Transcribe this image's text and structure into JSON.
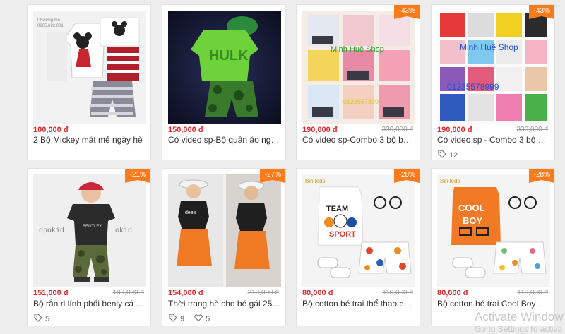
{
  "products": [
    {
      "price": "100,000 đ",
      "old_price": "",
      "discount": "",
      "name": "2 Bộ Mickey mát mẻ ngày hè",
      "tags": "",
      "comments": "",
      "thumb_text": "Phương mẹ\n0865.692.001"
    },
    {
      "price": "150,000 đ",
      "old_price": "",
      "discount": "",
      "name": "Có video sp-Bộ quần áo người...",
      "tags": "",
      "comments": "",
      "thumb_text": "HULK"
    },
    {
      "price": "190,000 đ",
      "old_price": "330,000 đ",
      "discount": "-43%",
      "name": "Có video sp-Combo 3 bộ bé g...",
      "tags": "",
      "comments": "",
      "thumb_text": "Minh Huệ Shop"
    },
    {
      "price": "190,000 đ",
      "old_price": "330,000 đ",
      "discount": "-43%",
      "name": "Có video sp - Combo 3 bộ bé t...",
      "tags": "12",
      "comments": "",
      "thumb_text": "Minh Huệ Shop",
      "thumb_text2": "01235578999"
    },
    {
      "price": "151,000 đ",
      "old_price": "189,000 đ",
      "discount": "-21%",
      "name": "Bộ rằn ri lính phối benly cá tín...",
      "tags": "5",
      "comments": "",
      "thumb_text": "BENTLEY"
    },
    {
      "price": "154,000 đ",
      "old_price": "210,000 đ",
      "discount": "-27%",
      "name": "Thời trang hè cho bé gái 25kg ...",
      "tags": "9",
      "comments": "5",
      "thumb_text": "dee's"
    },
    {
      "price": "80,000 đ",
      "old_price": "110,000 đ",
      "discount": "-28%",
      "name": "Bộ cotton bé trai thể thao cực ...",
      "tags": "",
      "comments": "",
      "thumb_text": "TEAM SPORT"
    },
    {
      "price": "80,000 đ",
      "old_price": "110,000 đ",
      "discount": "-28%",
      "name": "Bộ cotton bé trai Cool Boy cực...",
      "tags": "",
      "comments": "",
      "thumb_text": "COOL BOY"
    }
  ],
  "watermark": {
    "line1": "Activate Window",
    "line2": "Go to Settings to activa"
  }
}
